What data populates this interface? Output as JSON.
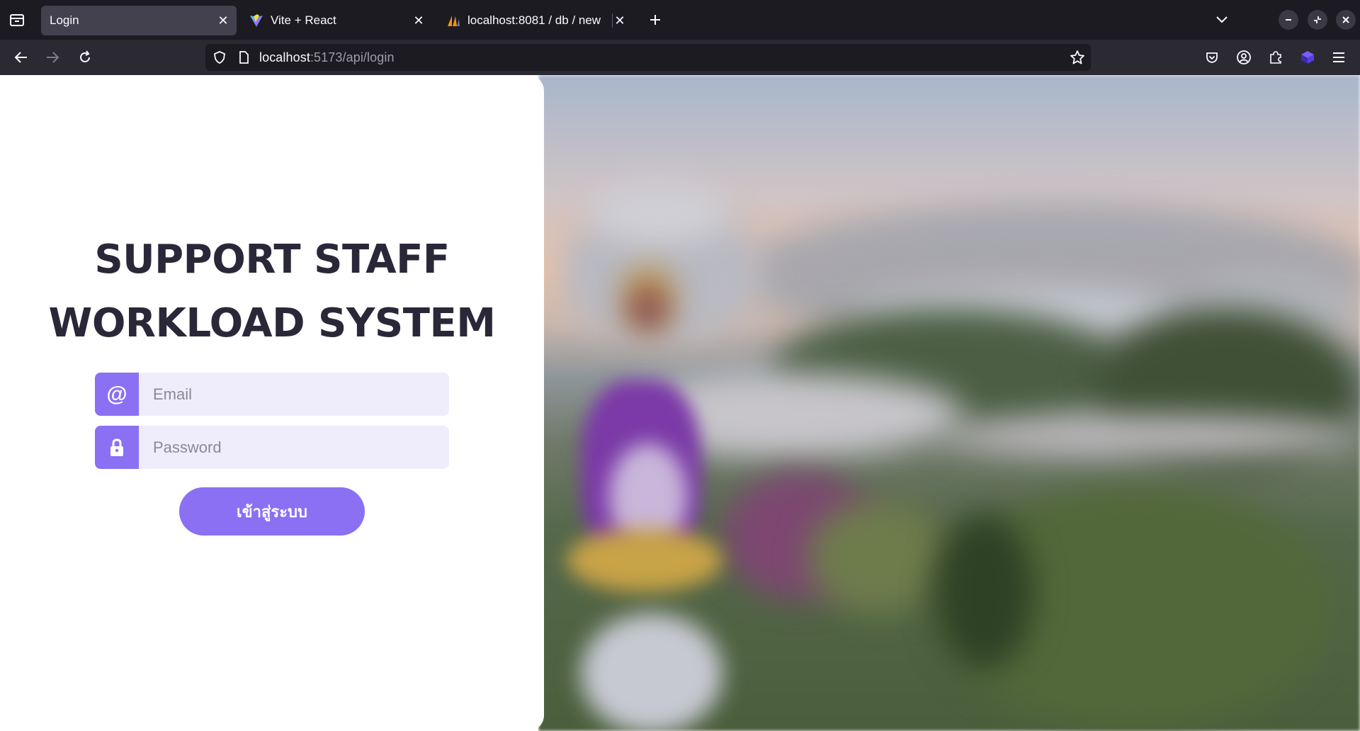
{
  "browser": {
    "tabs": [
      {
        "label": "Login",
        "active": true
      },
      {
        "label": "Vite + React",
        "active": false
      },
      {
        "label": "localhost:8081 / db / new",
        "active": false
      }
    ],
    "url_host": "localhost",
    "url_rest": ":5173/api/login"
  },
  "login": {
    "headline_line1": "SUPPORT STAFF",
    "headline_line2": "WORKLOAD SYSTEM",
    "email_icon": "@",
    "email_placeholder": "Email",
    "password_placeholder": "Password",
    "submit_label": "เข้าสู่ระบบ"
  },
  "colors": {
    "accent": "#8b70f4",
    "field_bg": "#efedfc",
    "headline": "#2a2838"
  }
}
